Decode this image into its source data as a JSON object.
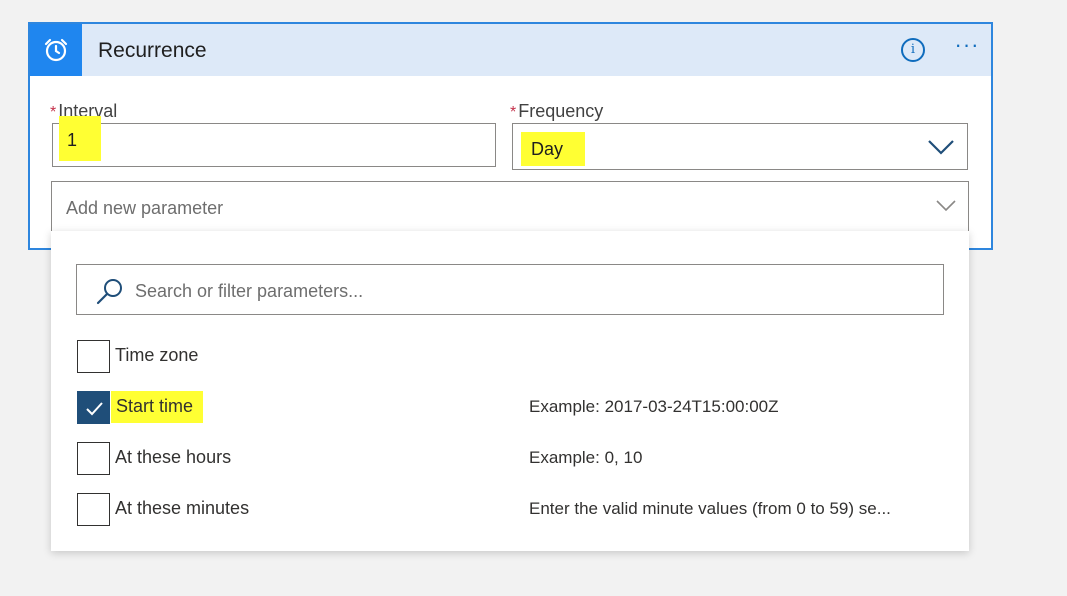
{
  "card": {
    "title": "Recurrence",
    "info_label": "i",
    "more_label": "···"
  },
  "interval": {
    "required_mark": "*",
    "label": "Interval",
    "value": "1"
  },
  "frequency": {
    "required_mark": "*",
    "label": "Frequency",
    "value": "Day"
  },
  "add_parameter": {
    "placeholder": "Add new parameter"
  },
  "search": {
    "placeholder": "Search or filter parameters..."
  },
  "options": [
    {
      "label": "Time zone",
      "checked": false,
      "example": ""
    },
    {
      "label": "Start time",
      "checked": true,
      "example": "Example: 2017-03-24T15:00:00Z"
    },
    {
      "label": "At these hours",
      "checked": false,
      "example": "Example: 0, 10"
    },
    {
      "label": "At these minutes",
      "checked": false,
      "example": "Enter the valid minute values (from 0 to 59) se..."
    }
  ],
  "colors": {
    "accent": "#1f86ef",
    "header_bg": "#dde9f8",
    "highlight": "#ffff33",
    "checkbox_checked": "#1f4e79"
  }
}
